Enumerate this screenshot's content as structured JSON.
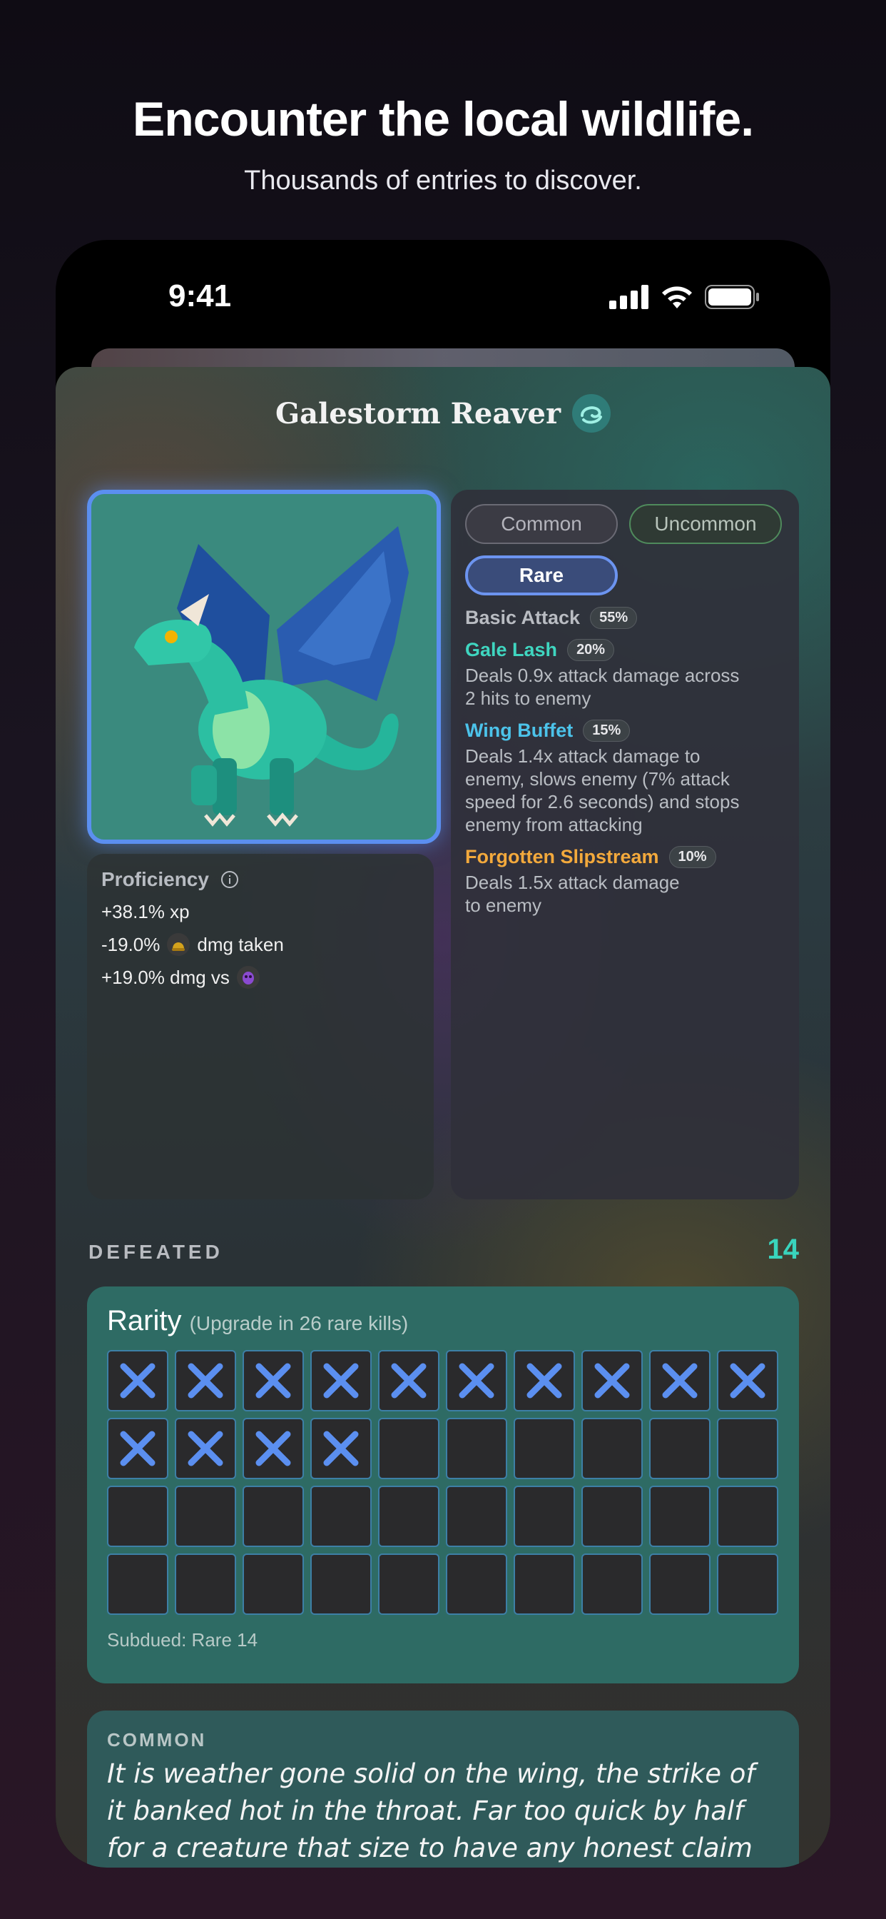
{
  "hero": {
    "title": "Encounter the local wildlife.",
    "subtitle": "Thousands of entries to discover."
  },
  "status_bar": {
    "time": "9:41"
  },
  "monster": {
    "name": "Galestorm Reaver",
    "portrait_icon": "teal-dragon-icon"
  },
  "proficiency": {
    "title": "Proficiency",
    "lines": [
      {
        "text": "+38.1% xp"
      },
      {
        "text": "-19.0%",
        "icon": "helmet-icon",
        "suffix": "dmg taken"
      },
      {
        "text": "+19.0% dmg vs",
        "icon": "purple-creature-icon"
      }
    ]
  },
  "rarity_tabs": [
    "Common",
    "Uncommon",
    "Rare"
  ],
  "selected_rarity": "Rare",
  "skills": [
    {
      "name": "Basic Attack",
      "pct": "55%",
      "color": "#b9bcc2",
      "desc": ""
    },
    {
      "name": "Gale Lash",
      "pct": "20%",
      "color": "#3fd6c0",
      "desc": "Deals 0.9x attack damage across\n2 hits to enemy"
    },
    {
      "name": "Wing Buffet",
      "pct": "15%",
      "color": "#4cc3ea",
      "desc": "Deals 1.4x attack damage to\nenemy, slows enemy (7% attack\nspeed for 2.6 seconds) and stops\nenemy from attacking"
    },
    {
      "name": "Forgotten Slipstream",
      "pct": "10%",
      "color": "#f3a93c",
      "desc": "Deals 1.5x attack damage\nto enemy"
    }
  ],
  "defeated": {
    "label": "DEFEATED",
    "count": "14"
  },
  "rarity_progress": {
    "title": "Rarity",
    "subtitle": "(Upgrade in 26 rare kills)",
    "filled": 14,
    "total": 40,
    "footer": "Subdued: Rare 14"
  },
  "lore": {
    "label": "COMMON",
    "text": "It is weather gone solid on the wing, the strike of it banked hot in the throat. Far too quick by half for a creature that size to have any honest claim to."
  }
}
